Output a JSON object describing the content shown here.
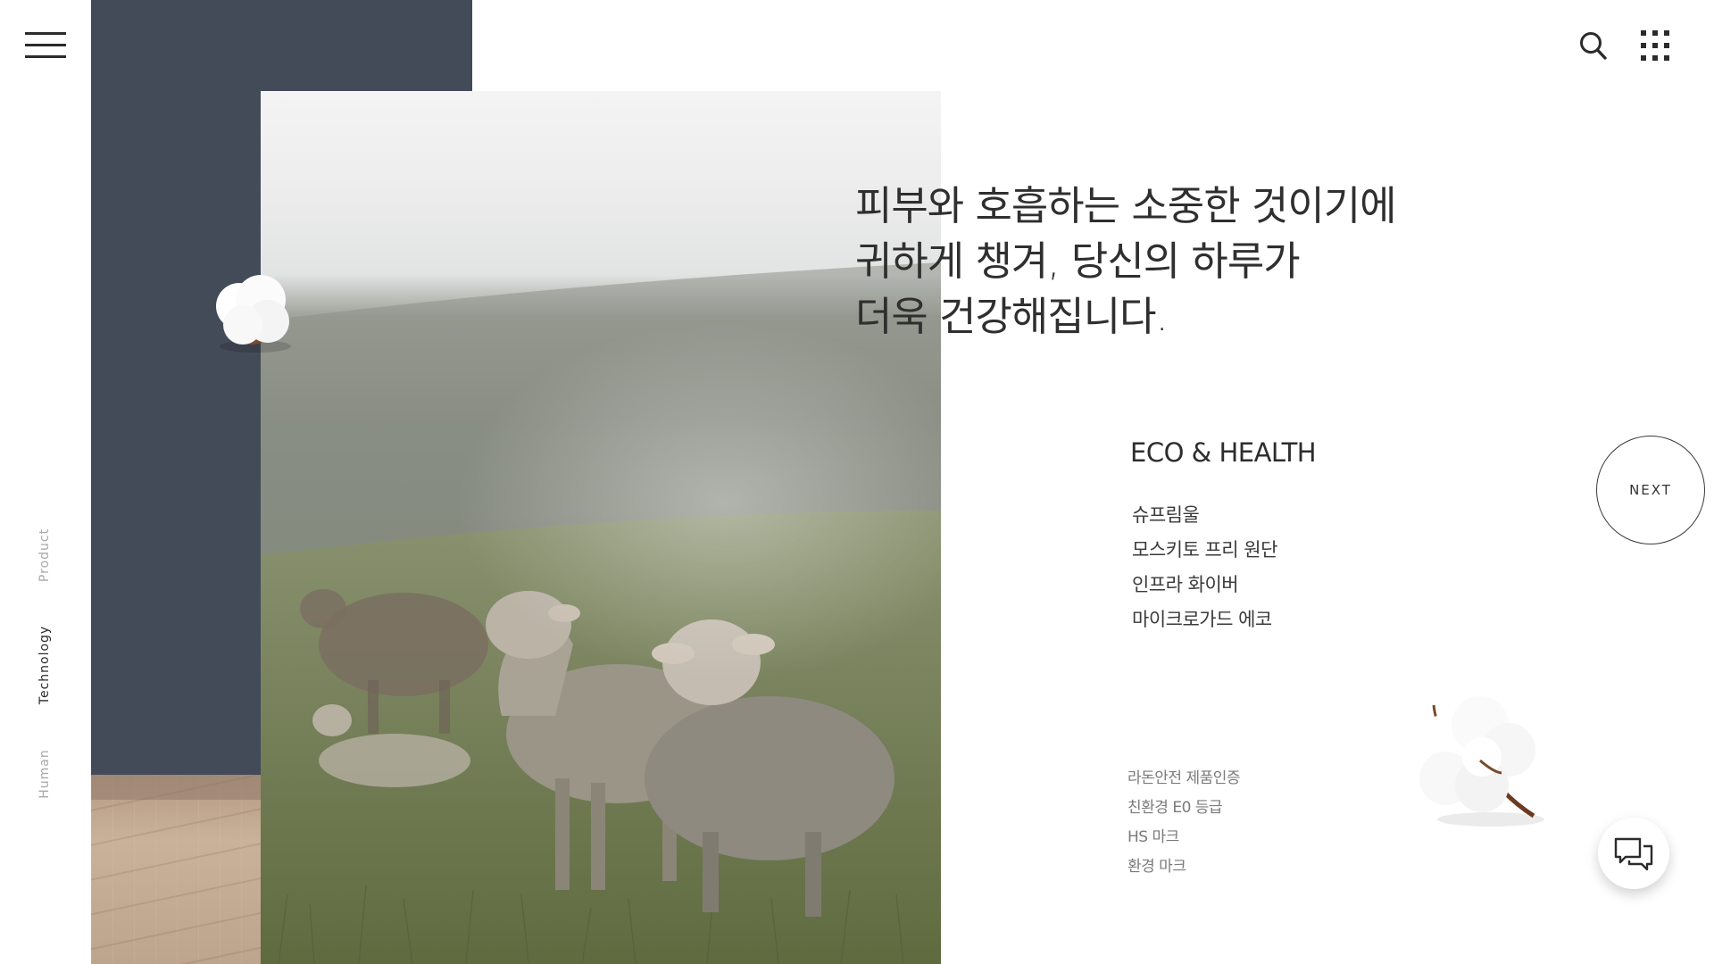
{
  "header": {
    "menu_icon": "hamburger-menu-icon",
    "search_icon": "search-icon",
    "apps_icon": "grid-apps-icon"
  },
  "side_nav": {
    "items": [
      {
        "label": "Product",
        "active": false
      },
      {
        "label": "Technology",
        "active": true
      },
      {
        "label": "Human",
        "active": false
      }
    ]
  },
  "hero": {
    "headline": [
      "피부와 호흡하는 소중한 것이기에",
      "귀하게 챙겨, 당신의 하루가",
      "더욱 건강해집니다."
    ]
  },
  "eco": {
    "title": "ECO & HEALTH",
    "items": [
      "슈프림울",
      "모스키토 프리 원단",
      "인프라 화이버",
      "마이크로가드 에코"
    ]
  },
  "certifications": {
    "items": [
      "라돈안전 제품인증",
      "친환경 E0 등급",
      "HS 마크",
      "환경 마크"
    ]
  },
  "controls": {
    "next_label": "NEXT",
    "chat_icon": "chat-bubbles-icon"
  },
  "colors": {
    "navy_panel": "#434b59",
    "text_dark": "#2f2f2f",
    "text_muted": "#7b7b7b"
  }
}
